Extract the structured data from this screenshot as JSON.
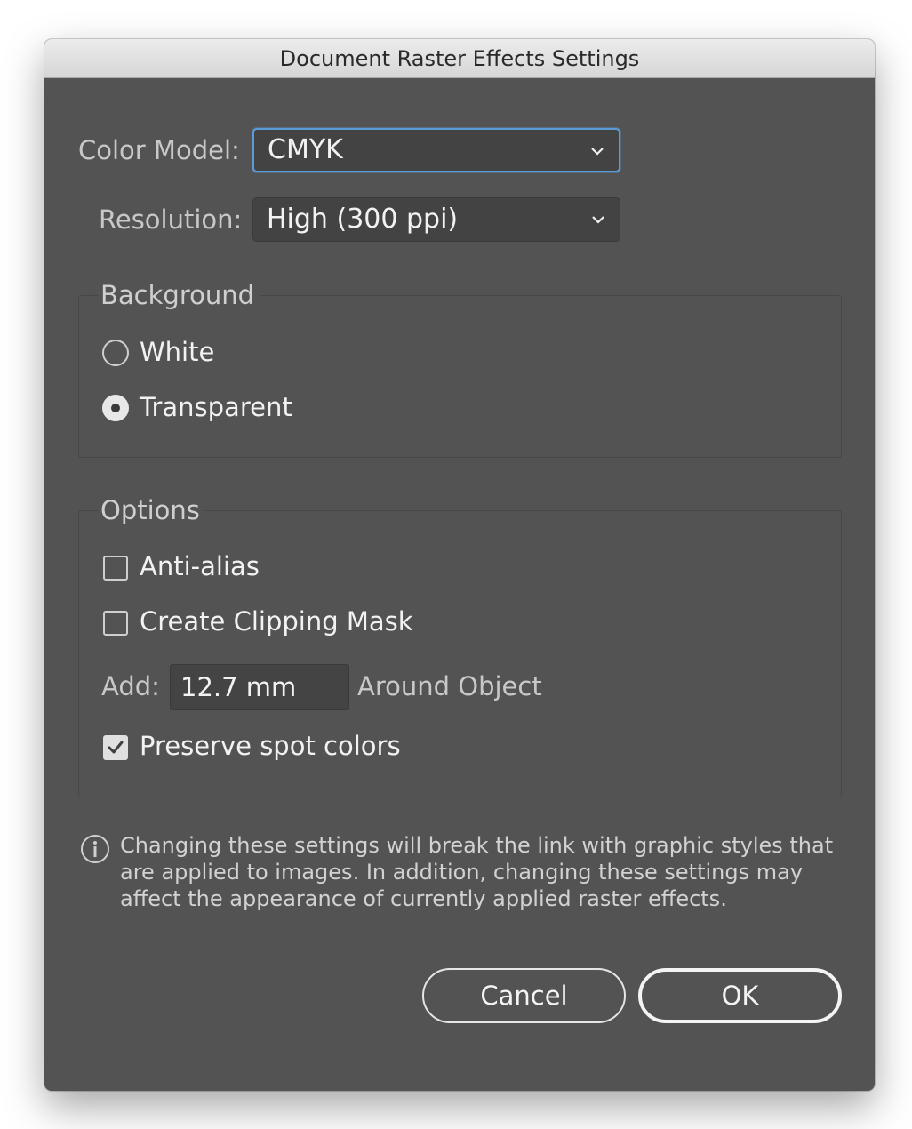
{
  "window": {
    "title": "Document Raster Effects Settings"
  },
  "color_model": {
    "label": "Color Model:",
    "value": "CMYK"
  },
  "resolution": {
    "label": "Resolution:",
    "value": "High (300 ppi)"
  },
  "background": {
    "title": "Background",
    "options": [
      {
        "label": "White",
        "selected": false
      },
      {
        "label": "Transparent",
        "selected": true
      }
    ]
  },
  "options": {
    "title": "Options",
    "anti_alias": {
      "label": "Anti-alias",
      "checked": false
    },
    "clipping_mask": {
      "label": "Create Clipping Mask",
      "checked": false
    },
    "add": {
      "label": "Add:",
      "value": "12.7 mm",
      "suffix": "Around Object"
    },
    "preserve_spot": {
      "label": "Preserve spot colors",
      "checked": true
    }
  },
  "info": {
    "icon": "info-icon",
    "text": "Changing these settings will break the link with graphic styles that are applied to images. In addition, changing these settings may affect the appearance of currently applied raster effects."
  },
  "buttons": {
    "cancel": "Cancel",
    "ok": "OK"
  },
  "colors": {
    "dialog_bg": "#535353",
    "focus_ring": "#5b9bd8"
  }
}
